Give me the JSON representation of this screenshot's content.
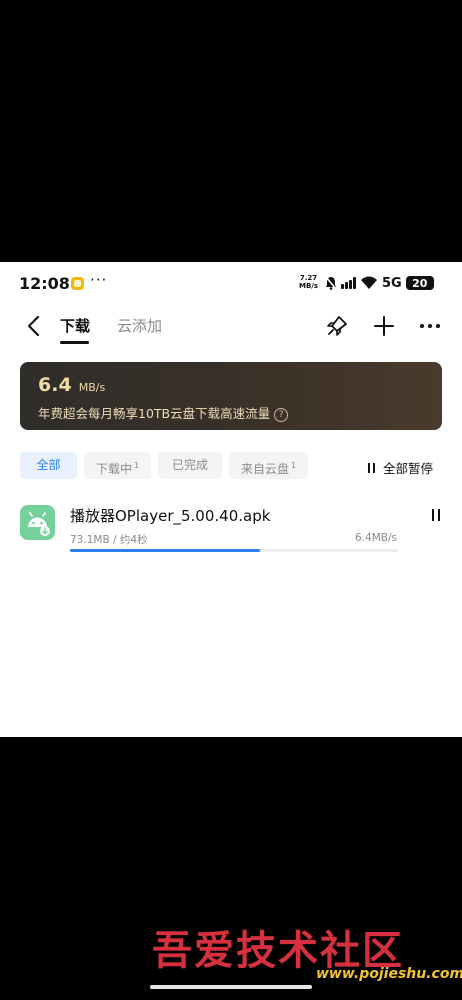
{
  "status_bar": {
    "time": "12:08",
    "net_speed_value": "7.27",
    "net_speed_unit": "MB/s",
    "network": "5G",
    "battery": "20",
    "more": "···"
  },
  "toolbar": {
    "tabs": [
      {
        "label": "下载",
        "active": true
      },
      {
        "label": "云添加",
        "active": false
      }
    ],
    "icons": [
      "back-arrow-icon",
      "rocket-icon",
      "plus-icon",
      "more-icon"
    ]
  },
  "banner": {
    "speed_value": "6.4",
    "speed_unit": "MB/s",
    "promo_text": "年费超会每月畅享10TB云盘下载高速流量",
    "help": "?"
  },
  "filters": [
    {
      "label": "全部",
      "count": "",
      "active": true
    },
    {
      "label": "下载中",
      "count": "1",
      "active": false
    },
    {
      "label": "已完成",
      "count": "",
      "active": false
    },
    {
      "label": "来自云盘",
      "count": "1",
      "active": false
    }
  ],
  "pause_all_label": "全部暂停",
  "downloads": [
    {
      "name": "播放器OPlayer_5.00.40.apk",
      "size_eta": "73.1MB / 约4秒",
      "speed": "6.4MB/s",
      "progress": 0.58
    }
  ],
  "watermark": {
    "title": "吾爱技术社区",
    "url": "www.pojieshu.com"
  },
  "colors": {
    "accent": "#2a7ff0",
    "banner_text": "#f4d9a8",
    "app_icon": "#74d19a"
  }
}
